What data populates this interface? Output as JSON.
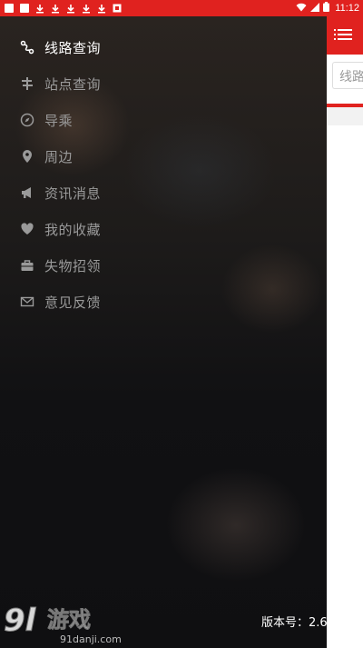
{
  "status_bar": {
    "time": "11:12",
    "background": "#e0221f"
  },
  "drawer": {
    "menu_items": [
      {
        "label": "线路查询",
        "icon": "route-icon",
        "active": true
      },
      {
        "label": "站点查询",
        "icon": "signpost-icon",
        "active": false
      },
      {
        "label": "导乘",
        "icon": "compass-icon",
        "active": false
      },
      {
        "label": "周边",
        "icon": "location-pin-icon",
        "active": false
      },
      {
        "label": "资讯消息",
        "icon": "megaphone-icon",
        "active": false
      },
      {
        "label": "我的收藏",
        "icon": "heart-icon",
        "active": false
      },
      {
        "label": "失物招领",
        "icon": "briefcase-icon",
        "active": false
      },
      {
        "label": "意见反馈",
        "icon": "mail-icon",
        "active": false
      }
    ],
    "version_text": "版本号：2.6"
  },
  "app": {
    "search_placeholder": "线路",
    "accent": "#e0221f"
  },
  "watermark": {
    "logo_text": "9l游戏",
    "site": "91danji.com"
  }
}
